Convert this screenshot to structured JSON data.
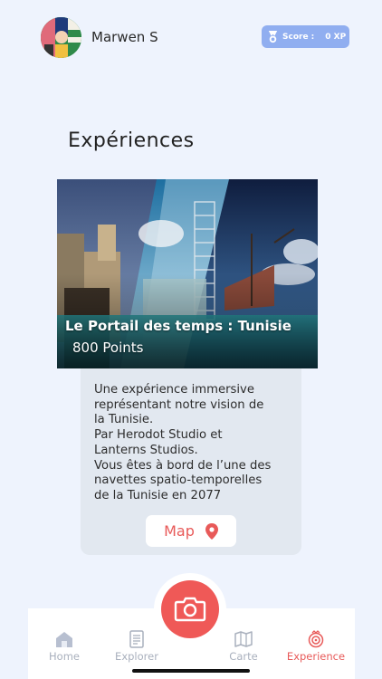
{
  "header": {
    "username": "Marwen S",
    "score_label": "Score :",
    "score_value": "0 XP"
  },
  "page": {
    "title": "Expériences"
  },
  "experience": {
    "title": "Le Portail des temps : Tunisie",
    "points": "800 Points",
    "description": "Une expérience immersive\nreprésentant notre vision de\nla Tunisie.\nPar Herodot Studio et\nLanterns Studios.\nVous êtes à bord de l’une des\nnavettes spatio-temporelles\nde la Tunisie en 2077",
    "map_label": "Map"
  },
  "tabs": [
    {
      "label": "Home",
      "icon": "home-icon"
    },
    {
      "label": "Explorer",
      "icon": "document-icon"
    },
    {
      "label": "Carte",
      "icon": "map-icon"
    },
    {
      "label": "Experience",
      "icon": "experience-icon"
    }
  ],
  "colors": {
    "accent": "#ef5957",
    "badge": "#90aef0",
    "background": "#eef3fd",
    "tab_inactive": "#a9b0bd"
  }
}
